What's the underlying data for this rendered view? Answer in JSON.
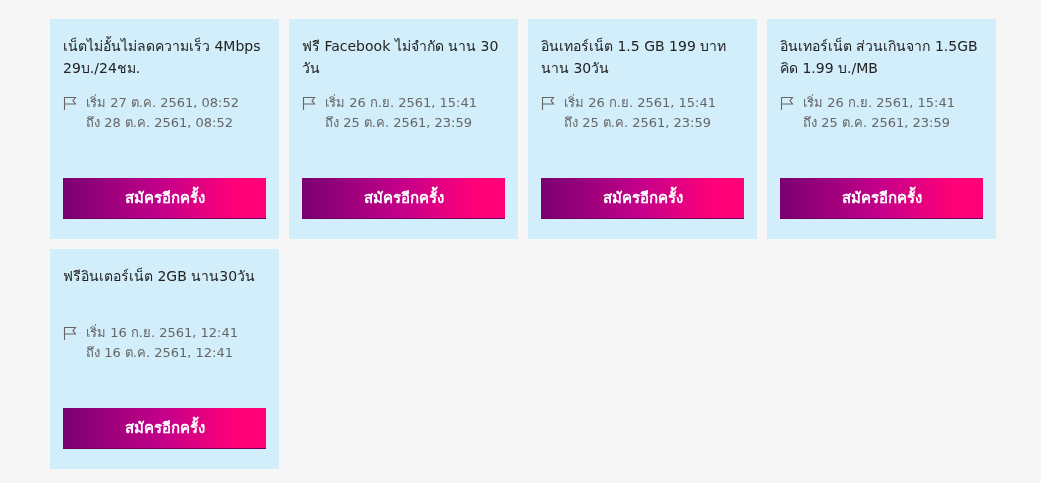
{
  "packages": [
    {
      "title": "เน็ตไม่อั้นไม่ลดความเร็ว 4Mbps 29บ./24ชม.",
      "start": "เริ่ม 27 ต.ค. 2561, 08:52",
      "end": "ถึง 28 ต.ค. 2561, 08:52",
      "button": "สมัครอีกครั้ง"
    },
    {
      "title": "ฟรี Facebook ไม่จำกัด นาน 30 วัน",
      "start": "เริ่ม 26 ก.ย. 2561, 15:41",
      "end": "ถึง 25 ต.ค. 2561, 23:59",
      "button": "สมัครอีกครั้ง"
    },
    {
      "title": "อินเทอร์เน็ต 1.5 GB 199 บาท นาน 30วัน",
      "start": "เริ่ม 26 ก.ย. 2561, 15:41",
      "end": "ถึง 25 ต.ค. 2561, 23:59",
      "button": "สมัครอีกครั้ง"
    },
    {
      "title": "อินเทอร์เน็ต ส่วนเกินจาก 1.5GB คิด 1.99 บ./MB",
      "start": "เริ่ม 26 ก.ย. 2561, 15:41",
      "end": "ถึง 25 ต.ค. 2561, 23:59",
      "button": "สมัครอีกครั้ง"
    },
    {
      "title": "ฟรีอินเตอร์เน็ต 2GB นาน30วัน",
      "start": "เริ่ม 16 ก.ย. 2561, 12:41",
      "end": "ถึง 16 ต.ค. 2561, 12:41",
      "button": "สมัครอีกครั้ง"
    }
  ]
}
